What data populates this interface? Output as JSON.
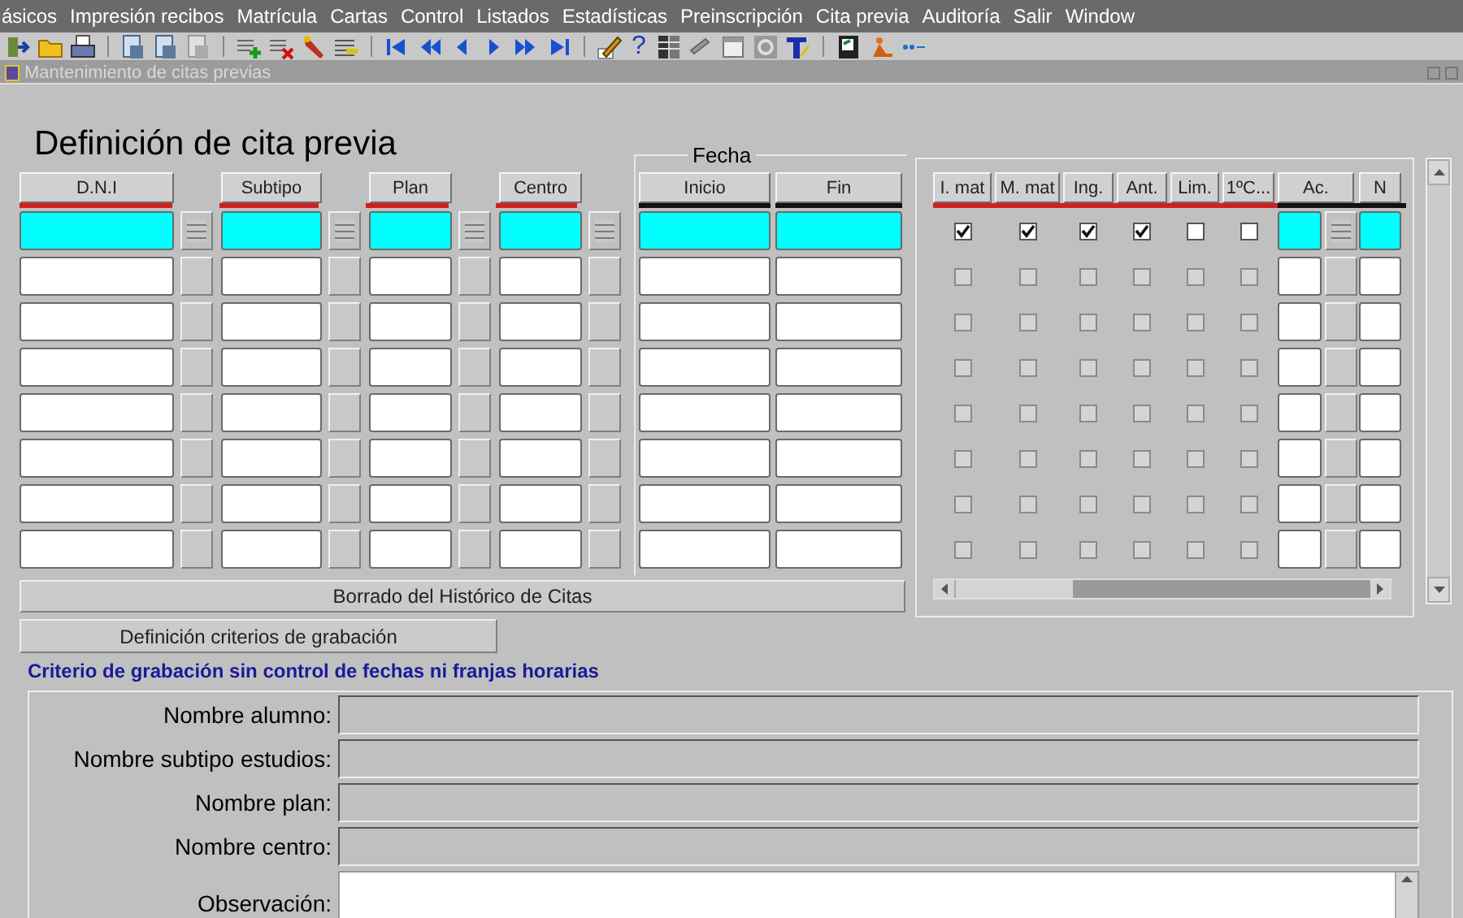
{
  "menu": [
    {
      "label": "ásicos"
    },
    {
      "label": "Impresión recibos"
    },
    {
      "label": "Matrícula"
    },
    {
      "label": "Cartas"
    },
    {
      "label": "Control"
    },
    {
      "label": "Listados"
    },
    {
      "label": "Estadísticas"
    },
    {
      "label": "Preinscripción"
    },
    {
      "label": "Cita previa"
    },
    {
      "label": "Auditoría"
    },
    {
      "label": "Salir"
    },
    {
      "label": "Window"
    }
  ],
  "toolbar": {
    "help_glyph": "?"
  },
  "window": {
    "title": "Mantenimiento de citas previas"
  },
  "form": {
    "title": "Definición de cita previa",
    "date_group_label": "Fecha",
    "columns": [
      {
        "label": "D.N.I",
        "kind": "lov"
      },
      {
        "label": "Subtipo",
        "kind": "lov"
      },
      {
        "label": "Plan",
        "kind": "lov"
      },
      {
        "label": "Centro",
        "kind": "lov"
      },
      {
        "label": "Inicio",
        "kind": "date"
      },
      {
        "label": "Fin",
        "kind": "date"
      }
    ],
    "flag_columns": [
      "I. mat",
      "M. mat",
      "Ing.",
      "Ant.",
      "Lim.",
      "1ºC..."
    ],
    "extra_columns": [
      {
        "label": "Ac.",
        "kind": "lov"
      },
      {
        "label": "N",
        "kind": "text"
      }
    ],
    "rows": [
      {
        "selected": true,
        "flags": [
          {
            "checked": true
          },
          {
            "checked": true
          },
          {
            "checked": true
          },
          {
            "checked": true
          },
          {
            "checked": false
          },
          {
            "checked": false
          }
        ]
      },
      {
        "selected": false,
        "flags": [
          {
            "checked": false
          },
          {
            "checked": false
          },
          {
            "checked": false
          },
          {
            "checked": false
          },
          {
            "checked": false
          },
          {
            "checked": false
          }
        ]
      },
      {
        "selected": false,
        "flags": [
          {
            "checked": false
          },
          {
            "checked": false
          },
          {
            "checked": false
          },
          {
            "checked": false
          },
          {
            "checked": false
          },
          {
            "checked": false
          }
        ]
      },
      {
        "selected": false,
        "flags": [
          {
            "checked": false
          },
          {
            "checked": false
          },
          {
            "checked": false
          },
          {
            "checked": false
          },
          {
            "checked": false
          },
          {
            "checked": false
          }
        ]
      },
      {
        "selected": false,
        "flags": [
          {
            "checked": false
          },
          {
            "checked": false
          },
          {
            "checked": false
          },
          {
            "checked": false
          },
          {
            "checked": false
          },
          {
            "checked": false
          }
        ]
      },
      {
        "selected": false,
        "flags": [
          {
            "checked": false
          },
          {
            "checked": false
          },
          {
            "checked": false
          },
          {
            "checked": false
          },
          {
            "checked": false
          },
          {
            "checked": false
          }
        ]
      },
      {
        "selected": false,
        "flags": [
          {
            "checked": false
          },
          {
            "checked": false
          },
          {
            "checked": false
          },
          {
            "checked": false
          },
          {
            "checked": false
          },
          {
            "checked": false
          }
        ]
      },
      {
        "selected": false,
        "flags": [
          {
            "checked": false
          },
          {
            "checked": false
          },
          {
            "checked": false
          },
          {
            "checked": false
          },
          {
            "checked": false
          },
          {
            "checked": false
          }
        ]
      }
    ],
    "delete_history_button": "Borrado del Histórico de Citas",
    "criteria_button": "Definición criterios de grabación",
    "criteria_note": "Criterio de grabación sin control de fechas ni franjas horarias",
    "detail_fields": [
      {
        "label": "Nombre alumno:",
        "kind": "text"
      },
      {
        "label": "Nombre subtipo estudios:",
        "kind": "text"
      },
      {
        "label": "Nombre plan:",
        "kind": "text"
      },
      {
        "label": "Nombre centro:",
        "kind": "text"
      },
      {
        "label": "Observación:",
        "kind": "textarea"
      }
    ]
  }
}
